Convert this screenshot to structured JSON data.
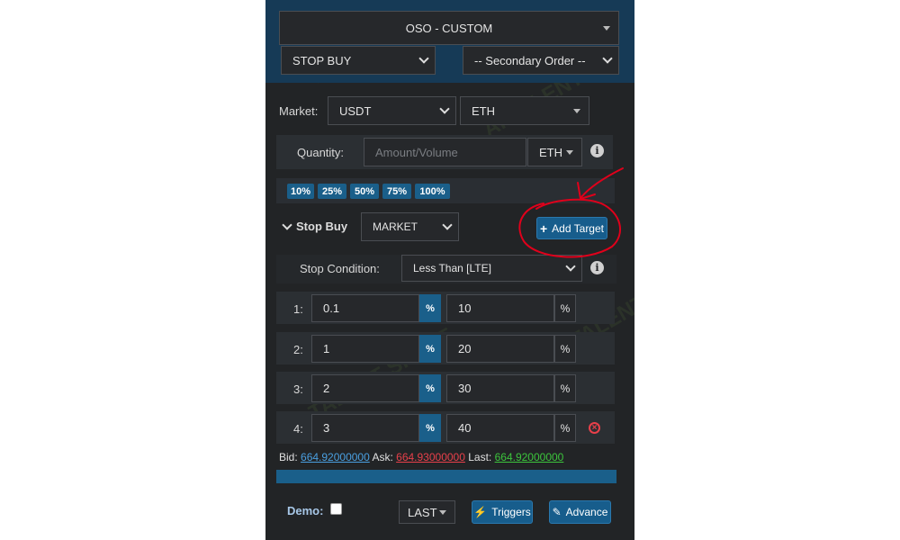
{
  "order_type": "OSO - CUSTOM",
  "primary_order": "STOP BUY",
  "secondary_order": "-- Secondary Order --",
  "market": {
    "label": "Market:",
    "base": "USDT",
    "quote": "ETH"
  },
  "quantity": {
    "label": "Quantity:",
    "placeholder": "Amount/Volume",
    "unit": "ETH"
  },
  "percent_buttons": [
    "10%",
    "25%",
    "50%",
    "75%",
    "100%"
  ],
  "stop_section": {
    "title": "Stop Buy",
    "type": "MARKET",
    "add_target": "Add Target"
  },
  "stop_condition": {
    "label": "Stop Condition:",
    "value": "Less Than [LTE]"
  },
  "targets": [
    {
      "index": "1:",
      "value": "0.1",
      "unit_btn": "%",
      "amount": "10",
      "amount_unit": "%"
    },
    {
      "index": "2:",
      "value": "1",
      "unit_btn": "%",
      "amount": "20",
      "amount_unit": "%"
    },
    {
      "index": "3:",
      "value": "2",
      "unit_btn": "%",
      "amount": "30",
      "amount_unit": "%"
    },
    {
      "index": "4:",
      "value": "3",
      "unit_btn": "%",
      "amount": "40",
      "amount_unit": "%"
    }
  ],
  "prices": {
    "bid_label": "Bid:",
    "bid": "664.92000000",
    "ask_label": "Ask:",
    "ask": "664.93000000",
    "last_label": "Last:",
    "last": "664.92000000"
  },
  "footer": {
    "demo_label": "Demo:",
    "last_btn": "LAST",
    "triggers": "Triggers",
    "advance": "Advance"
  },
  "watermark": "AI TALENT SPACE",
  "colors": {
    "accent": "#175d8c",
    "bid": "#4a9fe0",
    "ask": "#e8404a",
    "last": "#3cc43c",
    "annotation": "#e0001b"
  }
}
